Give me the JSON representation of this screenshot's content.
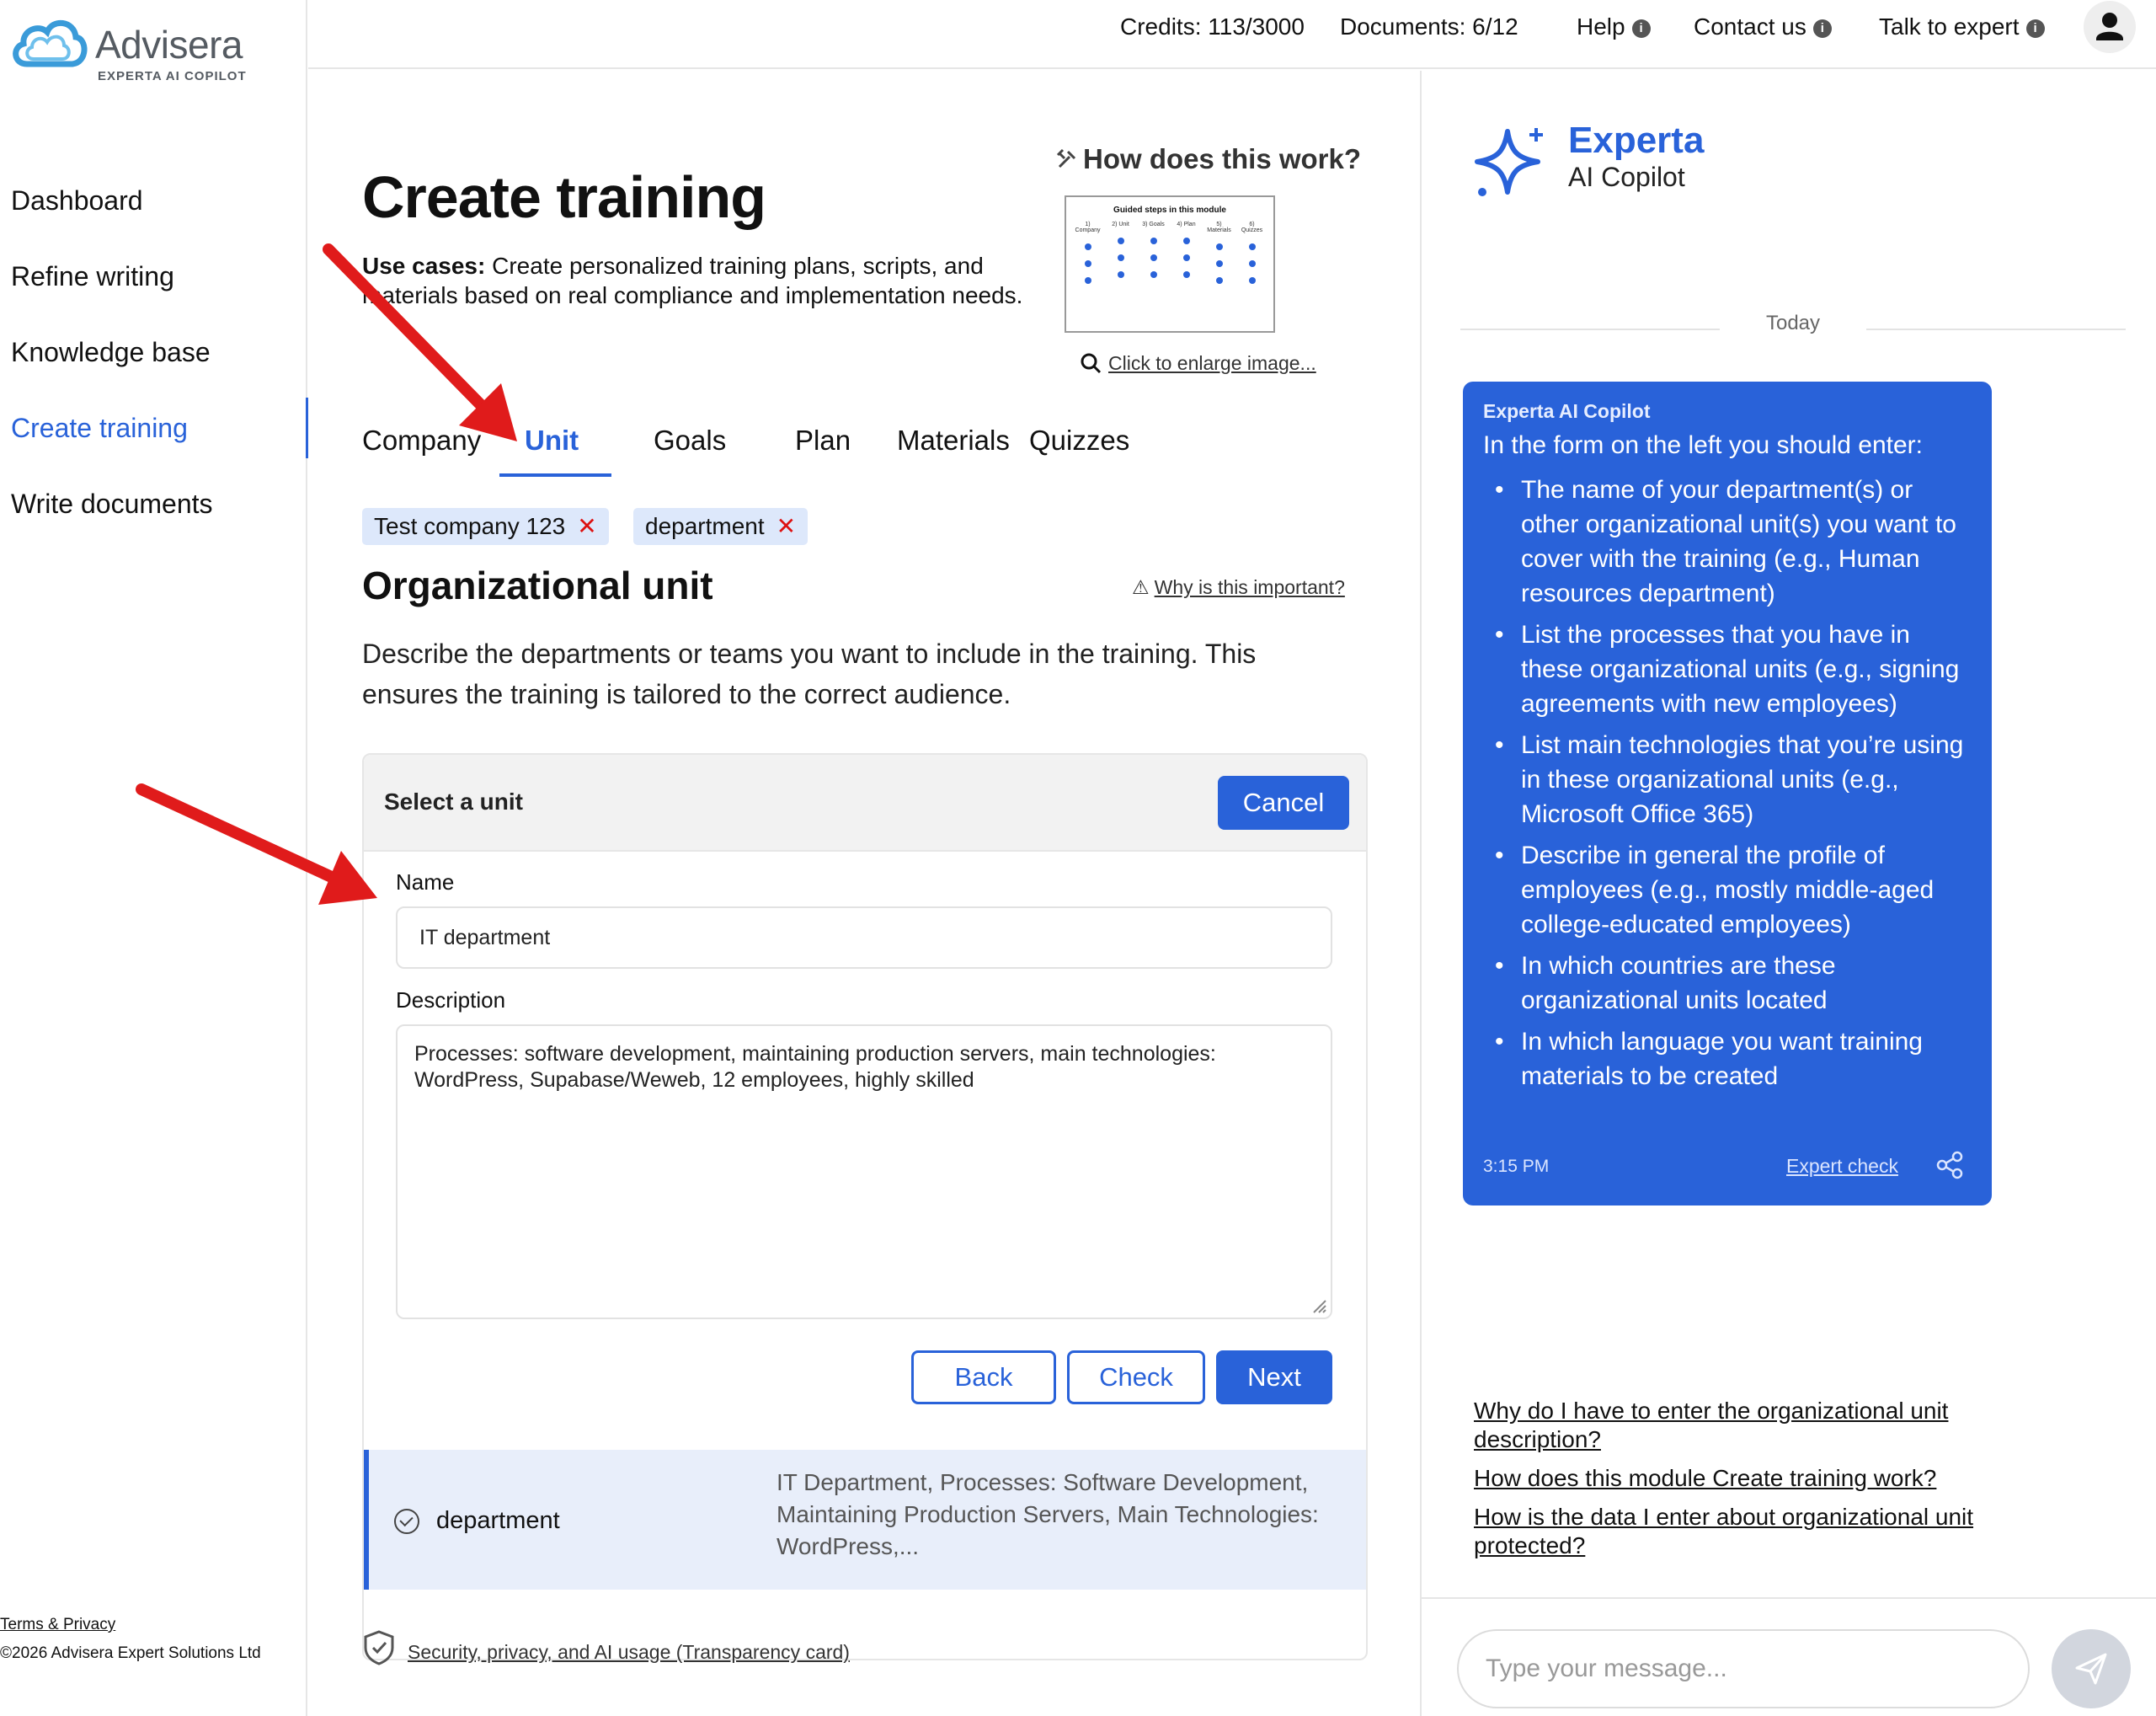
{
  "brand": {
    "name": "Advisera",
    "tagline": "EXPERTA AI COPILOT"
  },
  "sidebar": {
    "items": [
      {
        "label": "Dashboard",
        "active": false
      },
      {
        "label": "Refine writing",
        "active": false
      },
      {
        "label": "Knowledge base",
        "active": false
      },
      {
        "label": "Create training",
        "active": true
      },
      {
        "label": "Write documents",
        "active": false
      }
    ],
    "footer": {
      "terms": "Terms & Privacy",
      "copyright": "©2026 Advisera Expert Solutions Ltd"
    }
  },
  "topbar": {
    "credits": "Credits: 113/3000",
    "documents": "Documents: 6/12",
    "help": "Help",
    "contact": "Contact us",
    "talk": "Talk to expert",
    "info_glyph": "i"
  },
  "main": {
    "title": "Create training",
    "use_cases_label": "Use cases:",
    "use_cases_text": " Create personalized training plans, scripts, and materials based on real compliance and implementation needs.",
    "how_title": "How does this work?",
    "how_image": {
      "heading": "Guided steps in this module",
      "steps": [
        "1) Company",
        "2) Unit",
        "3) Goals",
        "4) Plan",
        "5) Materials",
        "6) Quizzes"
      ]
    },
    "enlarge": "Click to enlarge image...",
    "tabs": [
      {
        "label": "Company",
        "active": false
      },
      {
        "label": "Unit",
        "active": true
      },
      {
        "label": "Goals",
        "active": false
      },
      {
        "label": "Plan",
        "active": false
      },
      {
        "label": "Materials",
        "active": false
      },
      {
        "label": "Quizzes",
        "active": false
      }
    ],
    "chips": [
      {
        "label": "Test company 123",
        "remove": "✕"
      },
      {
        "label": "department",
        "remove": "✕"
      }
    ],
    "section_title": "Organizational unit",
    "why_label": "Why is this important?",
    "why_glyph": "⚠",
    "section_desc": "Describe the departments or teams you want to include in the training. This ensures the training is tailored to the correct audience.",
    "form": {
      "header_title": "Select a unit",
      "cancel": "Cancel",
      "name_label": "Name",
      "name_value": "IT department",
      "description_label": "Description",
      "description_value": "Processes: software development, maintaining production servers, main technologies: WordPress, Supabase/Weweb, 12 employees, highly skilled",
      "back": "Back",
      "check": "Check",
      "next": "Next"
    },
    "saved_unit": {
      "name": "department",
      "description": "IT Department, Processes: Software Development, Maintaining Production Servers, Main Technologies: WordPress,..."
    },
    "security_link": "Security, privacy, and AI usage (Transparency card)"
  },
  "chat": {
    "brand_name": "Experta",
    "brand_sub": "AI Copilot",
    "today": "Today",
    "message": {
      "sender": "Experta AI Copilot",
      "intro": "In the form on the left you should enter:",
      "bullets": [
        "The name of your department(s) or other organizational unit(s) you want to cover with the training (e.g., Human resources department)",
        "List the processes that you have in these organizational units (e.g., signing agreements with new employees)",
        "List main technologies that you’re using in these organizational units (e.g., Microsoft Office 365)",
        "Describe in general the profile of employees (e.g., mostly middle-aged college-educated employees)",
        "In which countries are these organizational units located",
        "In which language you want training materials to be created"
      ],
      "time": "3:15 PM",
      "expert_check": "Expert check"
    },
    "suggestions": [
      "Why do I have to enter the organizational unit description?",
      "How does this module Create training work?",
      "How is the data I enter about organizational unit protected?"
    ],
    "input_placeholder": "Type your message..."
  },
  "colors": {
    "accent": "#2962d9",
    "annotation_arrow": "#e01b1b",
    "chip_bg": "#dde8fb"
  },
  "icons": [
    "cloud-logo-icon",
    "info-icon",
    "user-icon",
    "tools-icon",
    "magnifier-icon",
    "close-icon",
    "warning-icon",
    "check-circle-icon",
    "shield-icon",
    "sparkle-icon",
    "share-icon",
    "send-icon"
  ]
}
